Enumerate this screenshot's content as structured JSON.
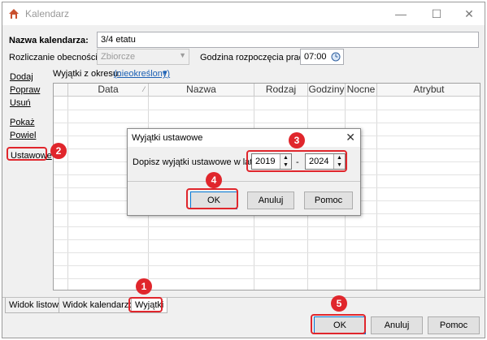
{
  "window": {
    "title": "Kalendarz",
    "minimize": "—",
    "maximize": "☐",
    "close": "✕"
  },
  "form": {
    "name_label": "Nazwa kalendarza:",
    "name_value": "3/4 etatu",
    "attendance_label": "Rozliczanie obecności:",
    "attendance_value": "Zbiorcze",
    "start_label": "Godzina rozpoczęcia pracy:",
    "start_value": "07:00"
  },
  "side_links": [
    "Dodaj",
    "Popraw",
    "Usuń",
    "Pokaż",
    "Powiel",
    "Ustawowe"
  ],
  "filter": {
    "label": "Wyjątki z okresu:",
    "value": "(nieokreślony)"
  },
  "grid": {
    "columns": [
      "Data",
      "Nazwa",
      "Rodzaj",
      "Godziny",
      "Nocne",
      "Atrybut"
    ]
  },
  "tabs": [
    "Widok listowy",
    "Widok kalendarzowy",
    "Wyjątki"
  ],
  "buttons": {
    "ok": "OK",
    "cancel": "Anuluj",
    "help": "Pomoc"
  },
  "dialog": {
    "title": "Wyjątki ustawowe",
    "close": "✕",
    "prompt": "Dopisz wyjątki ustawowe w latach",
    "year_from": "2019",
    "dash": "-",
    "year_to": "2024",
    "ok": "OK",
    "cancel": "Anuluj",
    "help": "Pomoc"
  },
  "markers": [
    "1",
    "2",
    "3",
    "4",
    "5"
  ],
  "colors": {
    "marker": "#e0262c",
    "link": "#1a5fb4",
    "accent": "#0078d7"
  }
}
